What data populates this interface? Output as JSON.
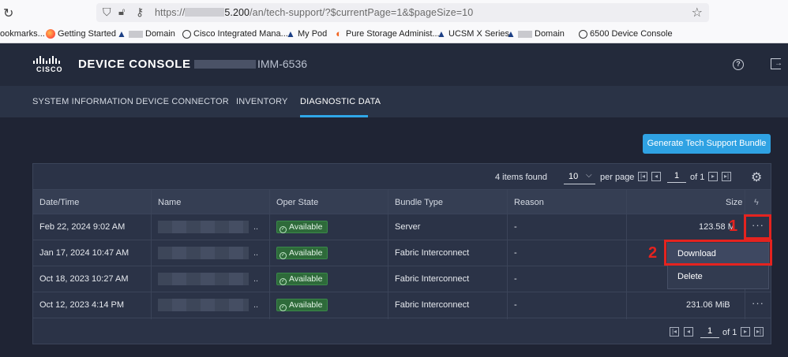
{
  "browser": {
    "url_prefix": "https://",
    "url_host_tail": "5.200",
    "url_path": "/an/tech-support/?$currentPage=1&$pageSize=10",
    "bookmarks": [
      {
        "label": "ookmarks...",
        "icon": "none"
      },
      {
        "label": "Getting Started",
        "icon": "firefox-icon"
      },
      {
        "label": "Domain",
        "icon": "triangle-icon",
        "blurred_prefix": true
      },
      {
        "label": "Cisco Integrated Mana...",
        "icon": "globe-icon"
      },
      {
        "label": "My Pod",
        "icon": "triangle-icon"
      },
      {
        "label": "Pure Storage Administ...",
        "icon": "pure-storage-icon"
      },
      {
        "label": "UCSM X Series",
        "icon": "triangle-icon"
      },
      {
        "label": "Domain",
        "icon": "triangle-icon",
        "blurred_prefix": true
      },
      {
        "label": "6500 Device Console",
        "icon": "globe-icon"
      }
    ]
  },
  "header": {
    "logo_text": "CISCO",
    "title": "DEVICE CONSOLE",
    "host_suffix": "IMM-6536"
  },
  "tabs": [
    {
      "label": "SYSTEM INFORMATION",
      "active": false
    },
    {
      "label": "DEVICE CONNECTOR",
      "active": false
    },
    {
      "label": "INVENTORY",
      "active": false
    },
    {
      "label": "DIAGNOSTIC DATA",
      "active": true
    }
  ],
  "actions": {
    "generate_label": "Generate Tech Support Bundle"
  },
  "toolbar": {
    "items_found": "4 items found",
    "page_size": "10",
    "per_page": "per page",
    "page": "1",
    "of_pages": "of 1"
  },
  "table": {
    "columns": [
      "Date/Time",
      "Name",
      "Oper State",
      "Bundle Type",
      "Reason",
      "Size"
    ],
    "rows": [
      {
        "date": "Feb 22, 2024 9:02 AM",
        "state": "Available",
        "type": "Server",
        "reason": "-",
        "size": "123.58 M"
      },
      {
        "date": "Jan 17, 2024 10:47 AM",
        "state": "Available",
        "type": "Fabric Interconnect",
        "reason": "-",
        "size": ""
      },
      {
        "date": "Oct 18, 2023 10:27 AM",
        "state": "Available",
        "type": "Fabric Interconnect",
        "reason": "-",
        "size": ""
      },
      {
        "date": "Oct 12, 2023 4:14 PM",
        "state": "Available",
        "type": "Fabric Interconnect",
        "reason": "-",
        "size": "231.06 MiB"
      }
    ],
    "name_ellipsis": ".."
  },
  "row_menu": {
    "download": "Download",
    "delete": "Delete"
  },
  "annotations": {
    "one": "1",
    "two": "2"
  },
  "colors": {
    "accent": "#2fa2e3",
    "annotation": "#e5231f",
    "available": "#2e6a3a"
  }
}
